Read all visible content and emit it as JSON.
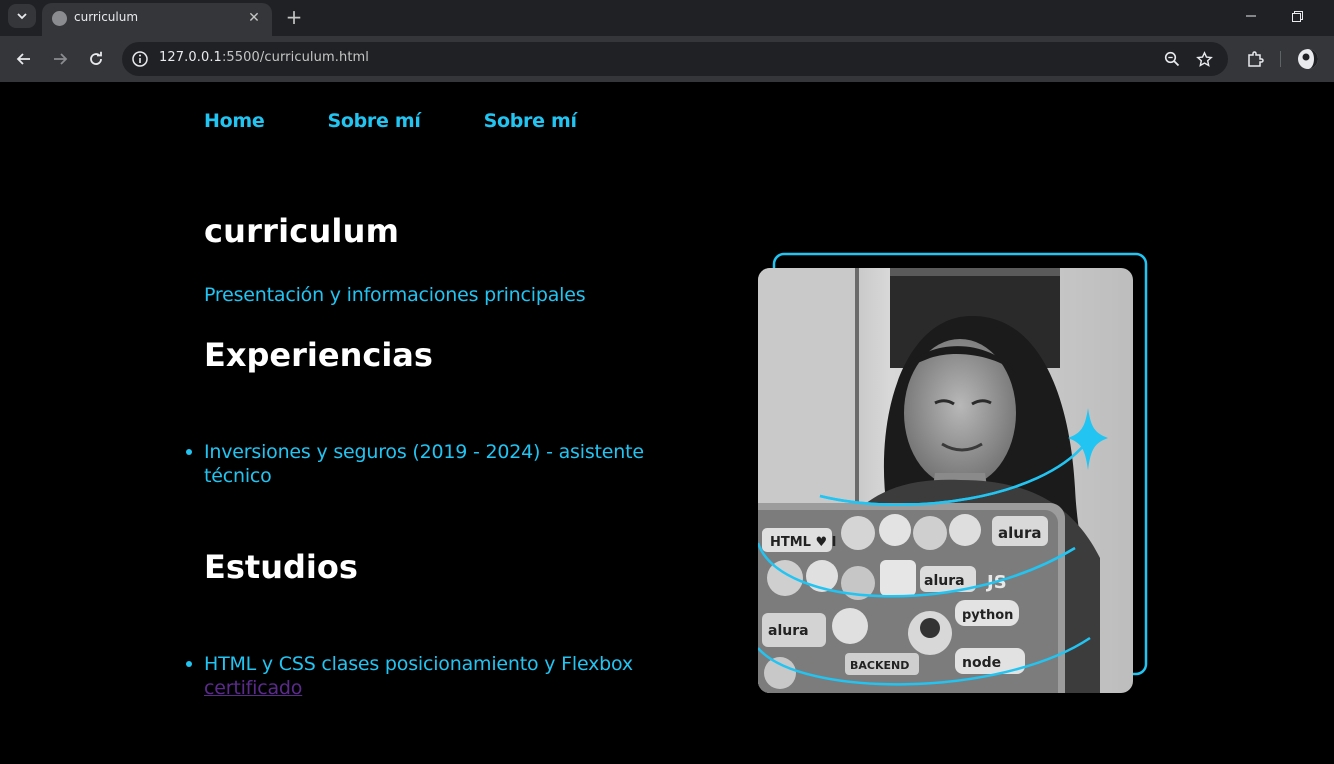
{
  "browser": {
    "tab_title": "curriculum",
    "url_host": "127.0.0.1",
    "url_rest": ":5500/curriculum.html"
  },
  "nav": {
    "items": [
      "Home",
      "Sobre mí",
      "Sobre mí"
    ]
  },
  "page": {
    "title": "curriculum",
    "subtitle": "Presentación y informaciones principales",
    "experiences_heading": "Experiencias",
    "experiences": [
      "Inversiones y seguros (2019 - 2024) - asistente técnico"
    ],
    "studies_heading": "Estudios",
    "studies": [
      {
        "text": "HTML y CSS clases posicionamiento y Flexbox",
        "link_label": "certificado"
      }
    ]
  },
  "image": {
    "laptop_stickers": [
      "HTML ♥ I",
      "alura",
      "JS",
      "alura",
      "python",
      "alura",
      "BACKEND",
      "node"
    ]
  },
  "colors": {
    "accent": "#22c4f2",
    "visited_link": "#5b2b8c",
    "background": "#000000"
  },
  "icons": [
    "tab-search-icon",
    "globe-icon",
    "close-icon",
    "plus-icon",
    "minimize-icon",
    "restore-icon",
    "back-icon",
    "forward-icon",
    "reload-icon",
    "info-icon",
    "zoom-icon",
    "star-icon",
    "extensions-icon",
    "profile-icon",
    "sparkle-icon"
  ]
}
